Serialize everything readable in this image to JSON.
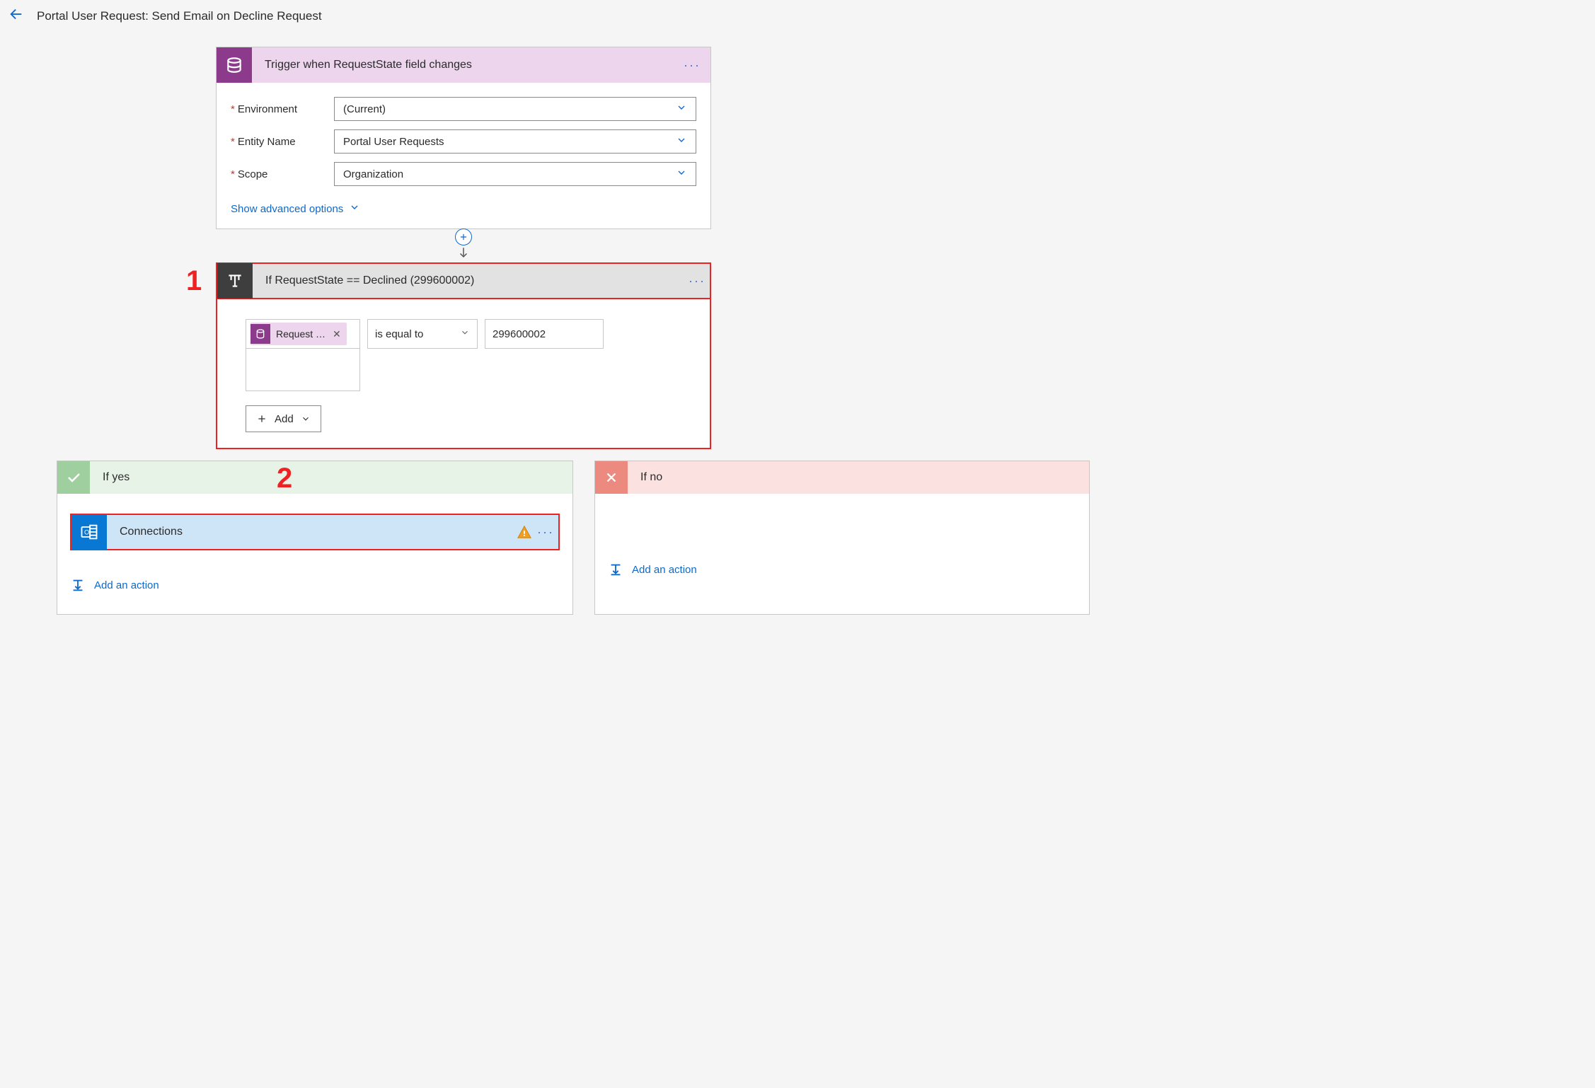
{
  "header": {
    "title": "Portal User Request: Send Email on Decline Request"
  },
  "trigger": {
    "title": "Trigger when RequestState field changes",
    "fields": {
      "environment": {
        "label": "Environment",
        "value": "(Current)"
      },
      "entity": {
        "label": "Entity Name",
        "value": "Portal User Requests"
      },
      "scope": {
        "label": "Scope",
        "value": "Organization"
      }
    },
    "advanced": "Show advanced options"
  },
  "condition": {
    "title": "If RequestState == Declined (299600002)",
    "left_chip": "Request …",
    "operator": "is equal to",
    "value": "299600002",
    "add": "Add"
  },
  "yes": {
    "title": "If yes",
    "action": "Connections",
    "addAction": "Add an action"
  },
  "no": {
    "title": "If no",
    "addAction": "Add an action"
  },
  "annotations": {
    "a1": "1",
    "a2": "2"
  }
}
